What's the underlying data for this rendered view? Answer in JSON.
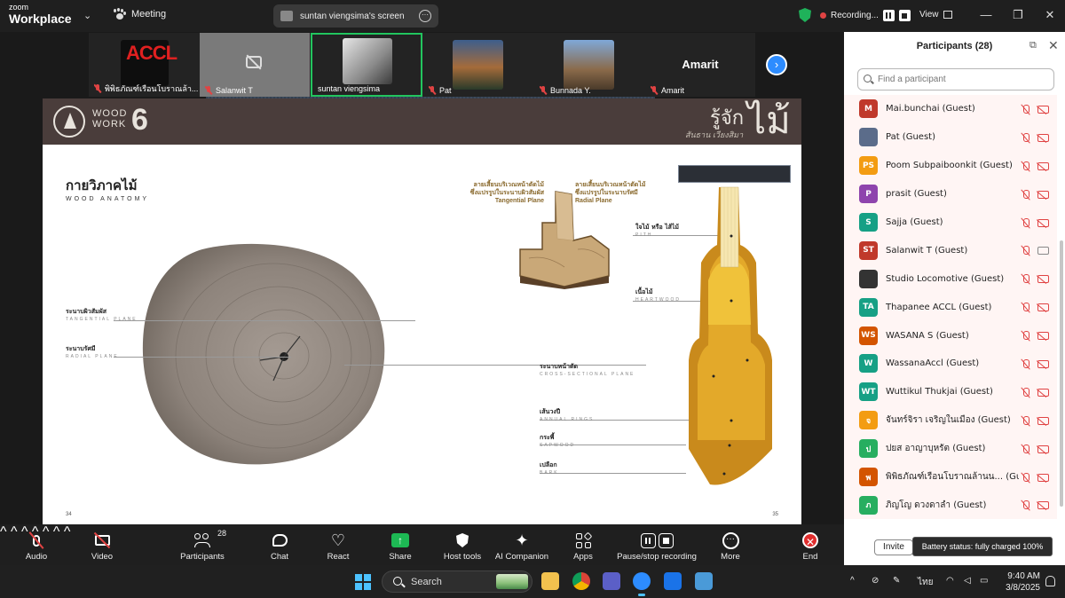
{
  "app": {
    "brand_small": "zoom",
    "brand_big": "Workplace",
    "meeting_label": "Meeting",
    "screen_share_label": "suntan viengsima's screen",
    "recording_label": "Recording...",
    "view_label": "View"
  },
  "video_strip": {
    "tiles": [
      {
        "name": "พิพิธภัณฑ์เรือนโบราณล้า...",
        "logo_text": "ACCL"
      },
      {
        "name": "Salanwit T"
      },
      {
        "name": "suntan viengsima"
      },
      {
        "name": "Pat"
      },
      {
        "name": "Bunnada Y."
      },
      {
        "name": "Amarit",
        "display_name": "Amarit"
      }
    ]
  },
  "slide": {
    "logo_text_1": "WOOD",
    "logo_text_2": "WORK",
    "logo_number": "6",
    "title_th": "รู้จัก",
    "title_big": "ไม้",
    "subtitle": "สันธาน เวียงสิมา",
    "section_title": "กายวิภาคไม้",
    "section_sub": "WOOD ANATOMY",
    "labels": {
      "tangential_th": "ระนาบผิวสัมผัส",
      "tangential_en": "TANGENTIAL PLANE",
      "radial_th": "ระนาบรัศมี",
      "radial_en": "RADIAL PLANE",
      "gold_tangential_th1": "ลายเสี้ยนบริเวณหน้าตัดไม้",
      "gold_tangential_th2": "ซึ่งแปรรูปในระนาบผิวสัมผัส",
      "gold_tangential_en": "Tangential Plane",
      "gold_radial_th1": "ลายเสี้ยนบริเวณหน้าตัดไม้",
      "gold_radial_th2": "ซึ่งแปรรูปในระนาบรัศมี",
      "gold_radial_en": "Radial Plane",
      "pith_th": "ใจไม้ หรือ ไส้ไม้",
      "pith_en": "PITH",
      "heartwood_th": "เนื้อไม้",
      "heartwood_en": "HEARTWOOD",
      "cross_th": "ระนาบหน้าตัด",
      "cross_en": "CROSS-SECTIONAL PLANE",
      "rings_th": "เส้นวงปี",
      "rings_en": "ANNUAL RINGS",
      "sapwood_th": "กระพี้",
      "sapwood_en": "SAPWOOD",
      "bark_th": "เปลือก",
      "bark_en": "BARK"
    },
    "page_left": "34",
    "page_right": "35"
  },
  "toolbar": {
    "audio": "Audio",
    "video": "Video",
    "participants": "Participants",
    "participants_count": "28",
    "chat": "Chat",
    "react": "React",
    "share": "Share",
    "host_tools": "Host tools",
    "ai_companion": "AI Companion",
    "apps": "Apps",
    "pause_recording": "Pause/stop recording",
    "more": "More",
    "end": "End"
  },
  "panel": {
    "title": "Participants (28)",
    "search_placeholder": "Find a participant",
    "invite_label": "Invite",
    "participants": [
      {
        "initials": "M",
        "name": "Mai.bunchai (Guest)",
        "color": "#c0392b",
        "cam": "off"
      },
      {
        "initials": "",
        "name": "Pat (Guest)",
        "color": "#5b6c8a",
        "cam": "off"
      },
      {
        "initials": "PS",
        "name": "Poom Subpaiboonkit (Guest)",
        "color": "#f39c12",
        "cam": "off"
      },
      {
        "initials": "P",
        "name": "prasit (Guest)",
        "color": "#8e44ad",
        "cam": "off"
      },
      {
        "initials": "S",
        "name": "Sajja (Guest)",
        "color": "#16a085",
        "cam": "off"
      },
      {
        "initials": "ST",
        "name": "Salanwit T (Guest)",
        "color": "#c0392b",
        "cam": "on"
      },
      {
        "initials": "",
        "name": "Studio Locomotive (Guest)",
        "color": "#333333",
        "cam": "off"
      },
      {
        "initials": "TA",
        "name": "Thapanee ACCL (Guest)",
        "color": "#16a085",
        "cam": "off"
      },
      {
        "initials": "WS",
        "name": "WASANA S (Guest)",
        "color": "#d35400",
        "cam": "off"
      },
      {
        "initials": "W",
        "name": "WassanaAccl (Guest)",
        "color": "#16a085",
        "cam": "off"
      },
      {
        "initials": "WT",
        "name": "Wuttikul Thukjai (Guest)",
        "color": "#16a085",
        "cam": "off"
      },
      {
        "initials": "จ",
        "name": "จันทร์จิรา เจริญในเมือง (Guest)",
        "color": "#f39c12",
        "cam": "off"
      },
      {
        "initials": "ป",
        "name": "ปยส อาญาบุหรัต (Guest)",
        "color": "#27ae60",
        "cam": "off"
      },
      {
        "initials": "พ",
        "name": "พิพิธภัณฑ์เรือนโบราณล้านน... (Guest)",
        "color": "#d35400",
        "cam": "off"
      },
      {
        "initials": "ภ",
        "name": "ภิญโญ ดวงดาลำ (Guest)",
        "color": "#27ae60",
        "cam": "off"
      }
    ]
  },
  "tooltip": "Battery status: fully charged 100%",
  "taskbar": {
    "search_label": "Search",
    "lang": "ไทย",
    "time": "9:40 AM",
    "date": "3/8/2025"
  }
}
